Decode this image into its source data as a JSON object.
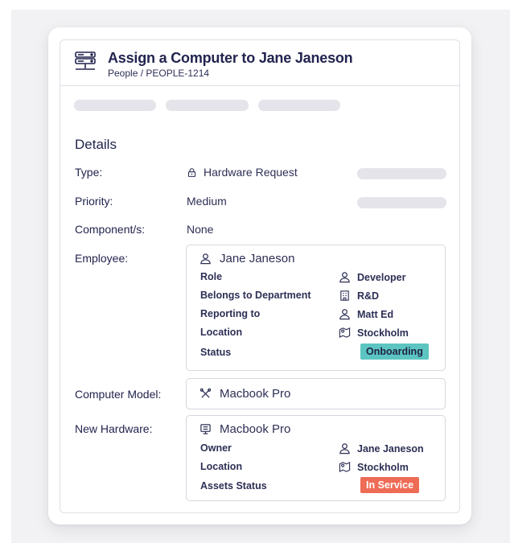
{
  "header": {
    "title": "Assign a Computer to Jane Janeson",
    "breadcrumb": "People / PEOPLE-1214"
  },
  "section_title": "Details",
  "fields": {
    "type_label": "Type:",
    "type_value": "Hardware Request",
    "priority_label": "Priority:",
    "priority_value": "Medium",
    "component_label": "Component/s:",
    "component_value": "None",
    "employee_label": "Employee:",
    "computer_model_label": "Computer Model:",
    "new_hardware_label": "New Hardware:"
  },
  "employee": {
    "name": "Jane Janeson",
    "rows": [
      {
        "key": "Role",
        "value": "Developer",
        "icon": "person-icon"
      },
      {
        "key": "Belongs to Department",
        "value": "R&D",
        "icon": "building-icon"
      },
      {
        "key": "Reporting to",
        "value": "Matt Ed",
        "icon": "person-icon"
      },
      {
        "key": "Location",
        "value": "Stockholm",
        "icon": "map-icon"
      },
      {
        "key": "Status",
        "value": "Onboarding",
        "badge_color": "#5cc5c1"
      }
    ]
  },
  "computer_model": {
    "value": "Macbook Pro",
    "icon": "tools-icon"
  },
  "new_hardware": {
    "name": "Macbook Pro",
    "icon": "monitor-icon",
    "rows": [
      {
        "key": "Owner",
        "value": "Jane Janeson",
        "icon": "person-icon"
      },
      {
        "key": "Location",
        "value": "Stockholm",
        "icon": "map-icon"
      },
      {
        "key": "Assets Status",
        "value": "In Service",
        "badge_color": "#ee6b55"
      }
    ]
  },
  "colors": {
    "title": "#22244f",
    "border": "#dedee6",
    "placeholder": "#e4e4ea"
  }
}
